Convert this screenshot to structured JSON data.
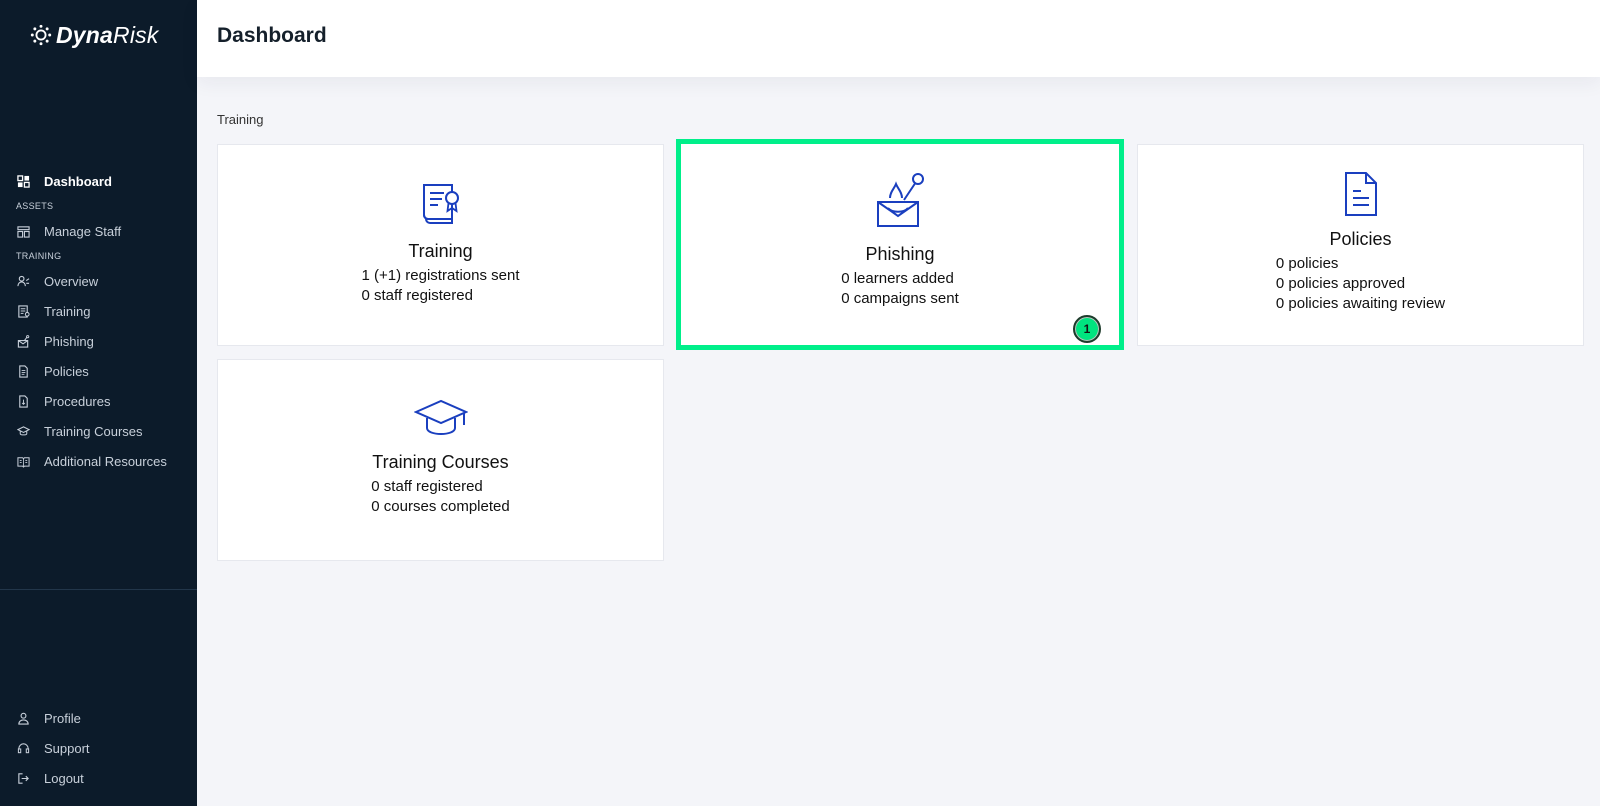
{
  "brand": {
    "name_bold": "Dyna",
    "name_light": "Risk"
  },
  "header": {
    "title": "Dashboard"
  },
  "sidebar": {
    "dashboard": "Dashboard",
    "assets_section": "ASSETS",
    "manage_staff": "Manage Staff",
    "training_section": "TRAINING",
    "items": [
      "Overview",
      "Training",
      "Phishing",
      "Policies",
      "Procedures",
      "Training Courses",
      "Additional Resources"
    ],
    "bottom": [
      "Profile",
      "Support",
      "Logout"
    ]
  },
  "main": {
    "section_label": "Training",
    "cards": [
      {
        "title": "Training",
        "lines": [
          "1 (+1) registrations sent",
          "0 staff registered"
        ]
      },
      {
        "title": "Phishing",
        "lines": [
          "0 learners added",
          "0 campaigns sent"
        ],
        "badge": "1"
      },
      {
        "title": "Policies",
        "lines": [
          "0 policies",
          "0 policies approved",
          "0 policies awaiting review"
        ]
      },
      {
        "title": "Training Courses",
        "lines": [
          "0 staff registered",
          "0 courses completed"
        ]
      }
    ]
  },
  "colors": {
    "sidebar_bg": "#0c1b2a",
    "accent_icon": "#1a3fbf",
    "highlight": "#00ef8a"
  },
  "icons": {
    "training": "certificate-icon",
    "phishing": "phishing-hook-icon",
    "policies": "document-icon",
    "courses": "graduation-cap-icon"
  }
}
